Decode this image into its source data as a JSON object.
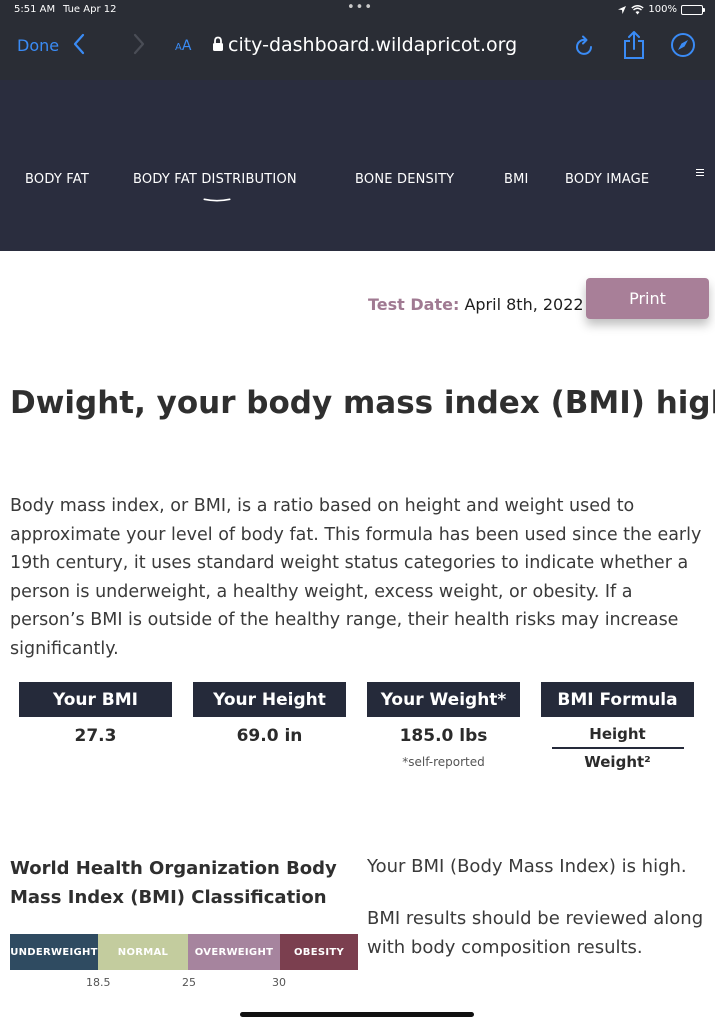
{
  "status_bar": {
    "time": "5:51 AM",
    "date": "Tue Apr 12",
    "dots": "•••",
    "battery": "100%"
  },
  "browser": {
    "done_label": "Done",
    "aa_label_small": "A",
    "aa_label_large": "A",
    "url": "city-dashboard.wildapricot.org",
    "accent_color": "#3a8bf5"
  },
  "nav": {
    "items": [
      {
        "label": "BODY FAT"
      },
      {
        "label": "BODY FAT DISTRIBUTION",
        "active": true
      },
      {
        "label": "BONE DENSITY"
      },
      {
        "label": "BMI"
      },
      {
        "label": "BODY IMAGE"
      }
    ]
  },
  "report": {
    "test_date_label": "Test Date:",
    "test_date_value": "April 8th, 2022",
    "print_label": "Print",
    "headline": "Dwight, your body mass index (BMI) high",
    "paragraph": "Body mass index, or BMI, is a ratio based on height and weight used to approximate your level of body fat. This formula has been used since the early 19th century, it uses standard weight status categories to indicate whether a person is underweight, a healthy weight, excess weight, or obesity. If a person’s BMI is outside of the healthy range, their health risks may increase significantly."
  },
  "stats": {
    "bmi": {
      "label": "Your BMI",
      "value": "27.3"
    },
    "height": {
      "label": "Your Height",
      "value": "69.0 in"
    },
    "weight": {
      "label": "Your Weight*",
      "value": "185.0 lbs",
      "note": "*self-reported"
    },
    "formula": {
      "label": "BMI Formula",
      "numerator": "Height",
      "denominator": "Weight²"
    }
  },
  "classification": {
    "title": "World Health Organization Body Mass Index (BMI) Classification",
    "segments": [
      "UNDERWEIGHT",
      "NORMAL",
      "OVERWEIGHT",
      "OBESITY"
    ],
    "ticks": [
      "18.5",
      "25",
      "30"
    ],
    "colors": {
      "underweight": "#2f4b61",
      "normal": "#c3cc9e",
      "overweight": "#a6849e",
      "obesity": "#7b3f4f"
    }
  },
  "result": {
    "line1": "Your BMI (Body Mass Index) is high.",
    "line2": "BMI results should be reviewed along with body composition results."
  }
}
